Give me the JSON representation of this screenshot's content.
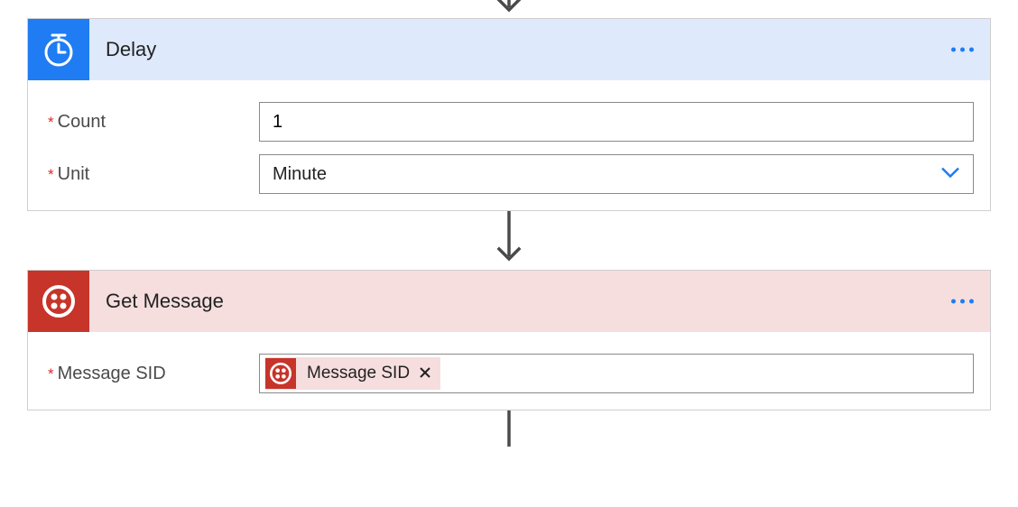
{
  "colors": {
    "delay_accent": "#1f7cf2",
    "delay_header_bg": "#dee9fb",
    "get_accent": "#c7342a",
    "get_header_bg": "#f6dede"
  },
  "steps": {
    "delay": {
      "title": "Delay",
      "icon": "timer-icon",
      "fields": {
        "count": {
          "label": "Count",
          "required": true,
          "value": "1"
        },
        "unit": {
          "label": "Unit",
          "required": true,
          "value": "Minute"
        }
      }
    },
    "get_message": {
      "title": "Get Message",
      "icon": "twilio-icon",
      "fields": {
        "message_sid": {
          "label": "Message SID",
          "required": true,
          "token": {
            "icon": "twilio-icon",
            "label": "Message SID",
            "removable": true
          }
        }
      }
    }
  }
}
